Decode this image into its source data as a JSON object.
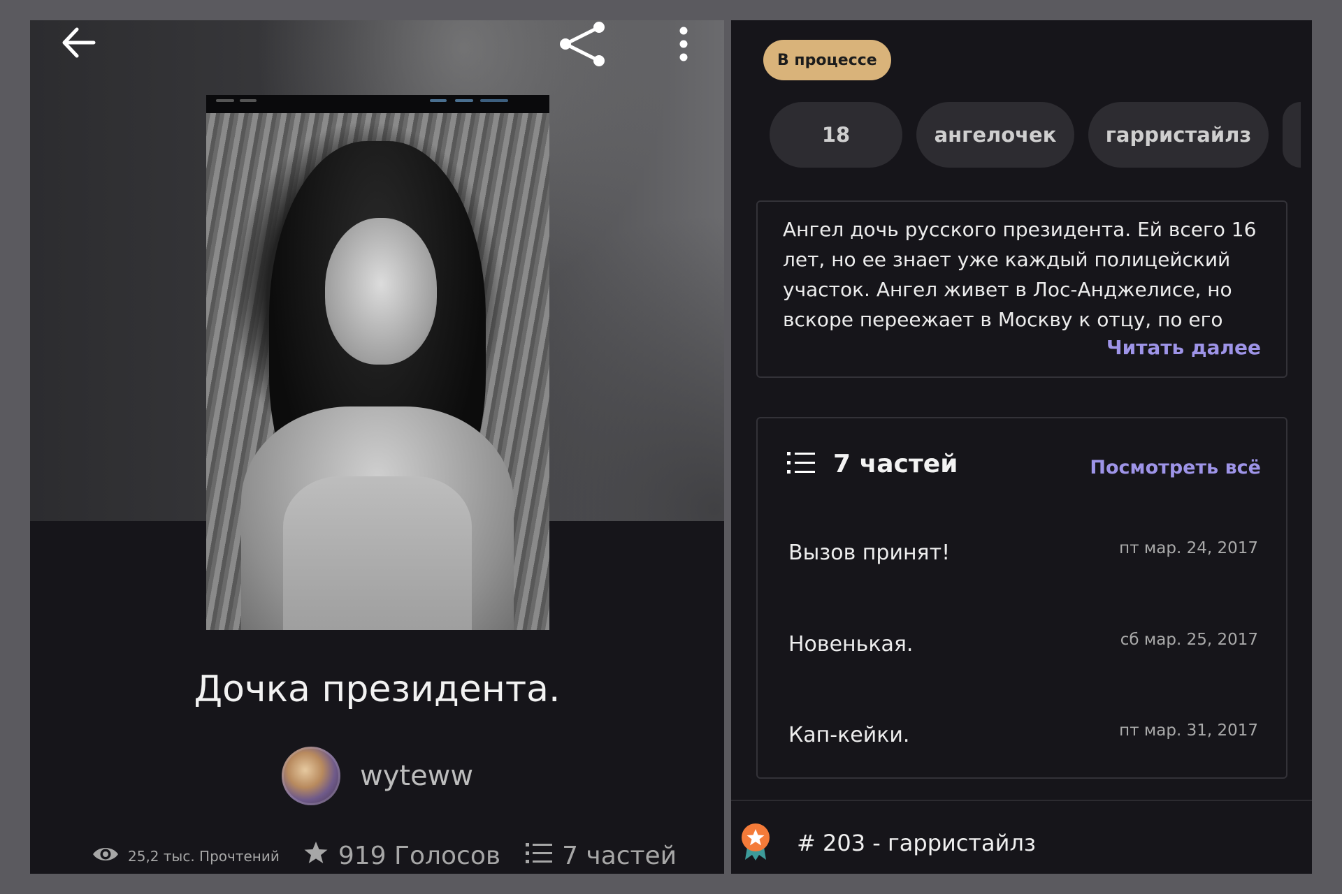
{
  "story": {
    "title": "Дочка президента.",
    "author": "wyteww",
    "stats": {
      "reads": "25,2 тыс. Прочтений",
      "votes": "919 Голосов",
      "parts": "7 частей"
    }
  },
  "header": {
    "icons": [
      "back-arrow-icon",
      "share-icon",
      "more-vertical-icon"
    ]
  },
  "details": {
    "status": "В процессе",
    "status_color": "#d9b37a",
    "accent_color": "#9e94e8",
    "tags": [
      "18",
      "ангелочек",
      "гарристайлз"
    ],
    "description": "Ангел дочь русского президента. Ей всего 16 лет, но ее знает уже каждый полицейский участок. Ангел живет в Лос-Анджелисе, но вскоре переежает в Москву к отцу, по его",
    "read_more": "Читать далее",
    "parts_header": "7 частей",
    "view_all": "Посмотреть всё",
    "parts": [
      {
        "title": "Вызов принят!",
        "date": "пт мар. 24, 2017"
      },
      {
        "title": "Новенькая.",
        "date": "сб мар. 25, 2017"
      },
      {
        "title": "Кап-кейки.",
        "date": "пт мар. 31, 2017"
      }
    ],
    "ranking": "# 203 - гарристайлз"
  }
}
